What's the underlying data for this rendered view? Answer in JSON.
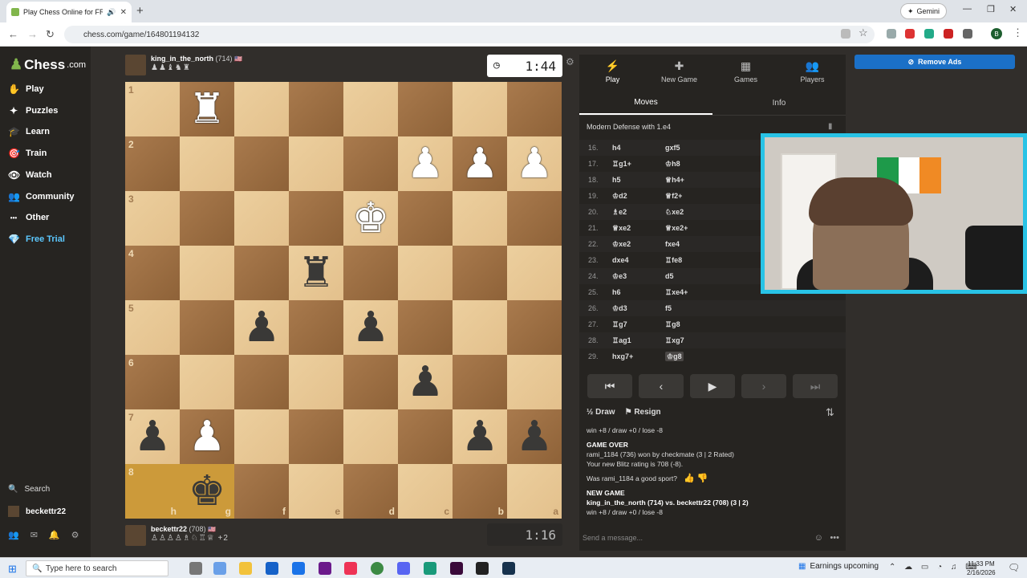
{
  "browser": {
    "tab_title": "Play Chess Online for FREE",
    "url": "chess.com/game/164801194132",
    "gemini_label": "Gemini",
    "profile_initial": "B"
  },
  "sidebar": {
    "logo": "Chess",
    "logo_suffix": ".com",
    "items": [
      {
        "label": "Play",
        "icon": "play-hand-icon",
        "glyph": "✋"
      },
      {
        "label": "Puzzles",
        "icon": "puzzle-icon",
        "glyph": "✦"
      },
      {
        "label": "Learn",
        "icon": "learn-icon",
        "glyph": "🎓"
      },
      {
        "label": "Train",
        "icon": "train-icon",
        "glyph": "🎯"
      },
      {
        "label": "Watch",
        "icon": "watch-icon",
        "glyph": "👁"
      },
      {
        "label": "Community",
        "icon": "community-icon",
        "glyph": "👥"
      },
      {
        "label": "Other",
        "icon": "more-icon",
        "glyph": "•••"
      },
      {
        "label": "Free Trial",
        "icon": "diamond-icon",
        "glyph": "💎"
      }
    ],
    "search_label": "Search",
    "user_label": "beckettr22"
  },
  "top_player": {
    "name": "king_in_the_north",
    "rating": "(714)",
    "captured": "♟♟♝♞♜",
    "clock": "1:44"
  },
  "bottom_player": {
    "name": "beckettr22",
    "rating": "(708)",
    "captured": "♙♙♙♙♗♘♖♕ +2",
    "clock": "1:16"
  },
  "board": {
    "orientation": "black",
    "highlight_squares": [
      "h8",
      "g8"
    ],
    "pieces": {
      "g1": "wR",
      "c2": "wP",
      "b2": "wP",
      "a2": "wP",
      "d3": "wK",
      "e4": "bR",
      "f5": "bP",
      "d5": "bP",
      "c6": "bP",
      "h7": "bP",
      "g7": "wP",
      "b7": "bP",
      "a7": "bP",
      "g8": "bK"
    }
  },
  "panel": {
    "tabs": [
      {
        "label": "Play",
        "glyph": "⚡"
      },
      {
        "label": "New Game",
        "glyph": "✚"
      },
      {
        "label": "Games",
        "glyph": "▦"
      },
      {
        "label": "Players",
        "glyph": "👥"
      }
    ],
    "subtabs": [
      "Moves",
      "Info"
    ],
    "opening": "Modern Defense with 1.e4",
    "moves": [
      {
        "n": "16.",
        "w": "h4",
        "b": "gxf5"
      },
      {
        "n": "17.",
        "w": "♖g1+",
        "b": "♔h8"
      },
      {
        "n": "18.",
        "w": "h5",
        "b": "♕h4+"
      },
      {
        "n": "19.",
        "w": "♔d2",
        "b": "♕f2+"
      },
      {
        "n": "20.",
        "w": "♗e2",
        "b": "♘xe2"
      },
      {
        "n": "21.",
        "w": "♕xe2",
        "b": "♕xe2+"
      },
      {
        "n": "22.",
        "w": "♔xe2",
        "b": "fxe4"
      },
      {
        "n": "23.",
        "w": "dxe4",
        "b": "♖fe8"
      },
      {
        "n": "24.",
        "w": "♔e3",
        "b": "d5"
      },
      {
        "n": "25.",
        "w": "h6",
        "b": "♖xe4+"
      },
      {
        "n": "26.",
        "w": "♔d3",
        "b": "f5"
      },
      {
        "n": "27.",
        "w": "♖g7",
        "b": "♖g8"
      },
      {
        "n": "28.",
        "w": "♖ag1",
        "b": "♖xg7"
      },
      {
        "n": "29.",
        "w": "hxg7+",
        "b": "♔g8"
      }
    ],
    "draw_label": "Draw",
    "resign_label": "Resign",
    "chat": {
      "line1": "win +8 / draw +0 / lose -8",
      "game_over": "GAME OVER",
      "result": "rami_1184 (736) won by checkmate (3 | 2 Rated)",
      "rating": "Your new Blitz rating is 708 (-8).",
      "sport": "Was rami_1184 a good sport?",
      "new_game": "NEW GAME",
      "matchup": "king_in_the_north (714) vs. beckettr22 (708) (3 | 2)",
      "line2": "win +8 / draw +0 / lose -8"
    },
    "send_placeholder": "Send a message..."
  },
  "remove_ads": "Remove Ads",
  "taskbar": {
    "search_placeholder": "Type here to search",
    "earnings": "Earnings upcoming",
    "time": "11:33 PM",
    "date": "2/16/2026"
  }
}
